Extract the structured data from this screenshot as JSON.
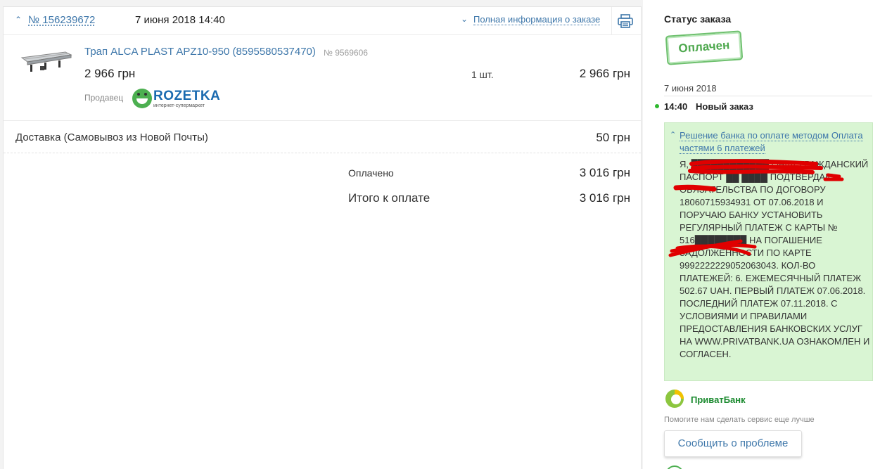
{
  "order": {
    "number": "№ 156239672",
    "date": "7 июня 2018 14:40",
    "full_info_link": "Полная информация о заказе"
  },
  "product": {
    "name": "Трап ALCA PLAST APZ10-950 (8595580537470)",
    "code": "№ 9569606",
    "price": "2 966 грн",
    "quantity": "1 шт.",
    "total": "2 966 грн",
    "seller_label": "Продавец",
    "seller_name": "ROZETKA",
    "seller_tagline": "интернет-супермаркет"
  },
  "delivery": {
    "label": "Доставка (Самовывоз из Новой Почты)",
    "price": "50 грн"
  },
  "summary": {
    "paid_label": "Оплачено",
    "paid_value": "3 016 грн",
    "total_label": "Итого к оплате",
    "total_value": "3 016 грн"
  },
  "status": {
    "title": "Статус заказа",
    "stamp": "Оплачен",
    "date": "7 июня 2018",
    "event_time": "14:40",
    "event_name": "Новый заказ",
    "bank_link": "Решение банка по оплате методом Оплата частями 6 платежей",
    "bank_text": "Я, ████████████ ОБЩЕГРАЖДАНСКИЙ ПАСПОРТ ██ ████ ПОДТВЕРДАЮ ОБЯЗАТЕЛЬСТВА ПО ДОГОВОРУ 18060715934931 ОТ 07.06.2018 И ПОРУЧАЮ БАНКУ УСТАНОВИТЬ РЕГУЛЯРНЫЙ ПЛАТЕЖ С КАРТЫ № 516████████ НА ПОГАШЕНИЕ ЗАДОЛЖЕННОСТИ ПО КАРТЕ 9992222229052063043. КОЛ-ВО ПЛАТЕЖЕЙ: 6. ЕЖЕМЕСЯЧНЫЙ ПЛАТЕЖ 502.67 UAH. ПЕРВЫЙ ПЛАТЕЖ 07.06.2018. ПОСЛЕДНИЙ ПЛАТЕЖ 07.11.2018. С УСЛОВИЯМИ И ПРАВИЛАМИ ПРЕДОСТАВЛЕНИЯ БАНКОВСКИХ УСЛУГ НА WWW.PRIVATBANK.UA ОЗНАКОМЛЕН И СОГЛАСЕН.",
    "bank_name": "ПриватБанк",
    "help_text": "Помогите нам сделать сервис еще лучше",
    "report_button": "Сообщить о проблеме"
  },
  "colors": {
    "link": "#3e77aa",
    "paid_green": "#4ea84e",
    "bank_box": "#d9f5d3",
    "redaction": "#e00000"
  }
}
